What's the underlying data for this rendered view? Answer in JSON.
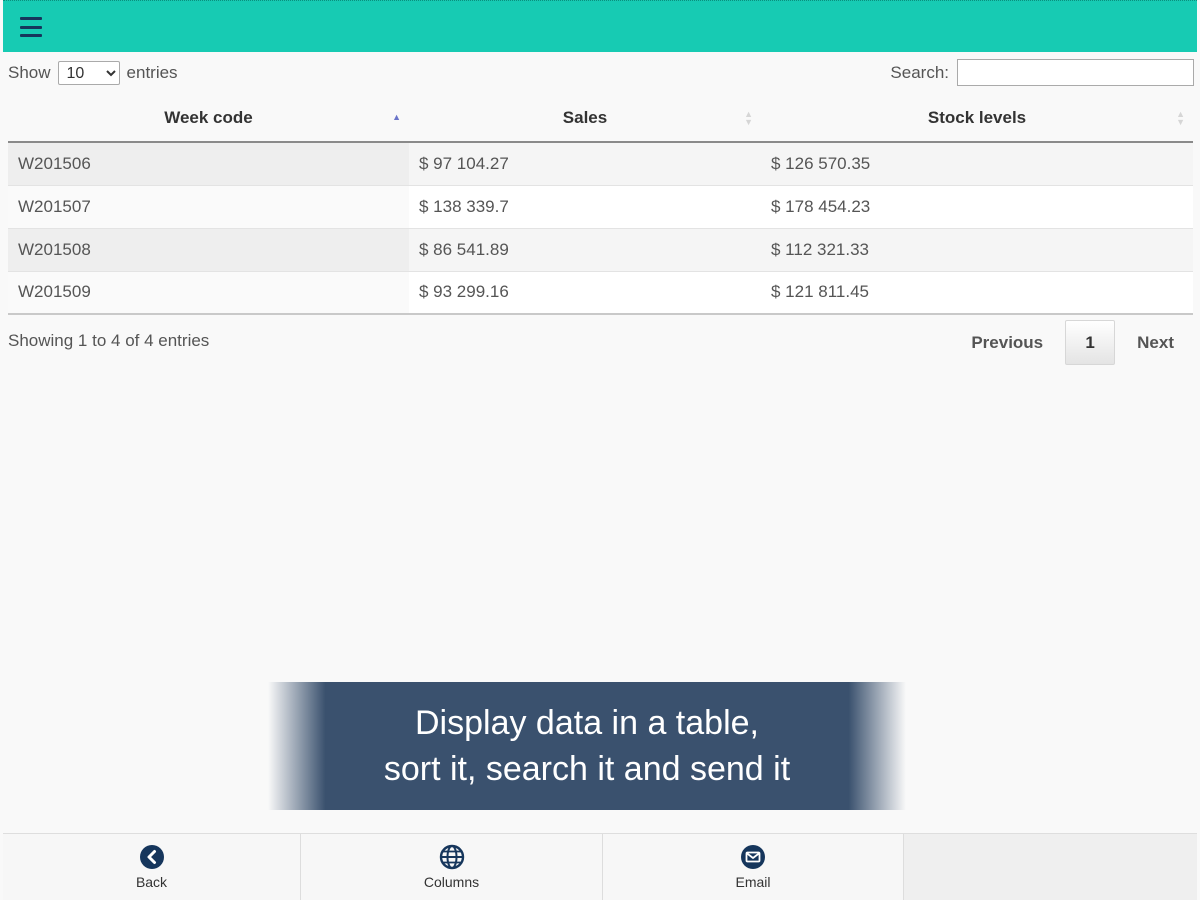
{
  "header": {
    "menu_icon": "hamburger-menu-icon"
  },
  "controls": {
    "show_label": "Show",
    "entries_label": "entries",
    "page_length": "10",
    "search_label": "Search:",
    "search_value": ""
  },
  "table": {
    "columns": [
      "Week code",
      "Sales",
      "Stock levels"
    ],
    "sorted_column": "Week code",
    "sort_direction": "ascending",
    "rows": [
      [
        "W201506",
        "$ 97 104.27",
        "$ 126 570.35"
      ],
      [
        "W201507",
        "$ 138 339.7",
        "$ 178 454.23"
      ],
      [
        "W201508",
        "$ 86 541.89",
        "$ 112 321.33"
      ],
      [
        "W201509",
        "$ 93 299.16",
        "$ 121 811.45"
      ]
    ]
  },
  "footer": {
    "info": "Showing 1 to 4 of 4 entries",
    "previous": "Previous",
    "current_page": "1",
    "next": "Next"
  },
  "overlay": {
    "line1": "Display data in a table,",
    "line2": "sort it, search it and send it"
  },
  "toolbar": {
    "back": {
      "label": "Back",
      "icon": "back-arrow-icon"
    },
    "columns": {
      "label": "Columns",
      "icon": "grid-globe-icon"
    },
    "email": {
      "label": "Email",
      "icon": "envelope-icon"
    }
  },
  "colors": {
    "topbar": "#17cbb3",
    "icon_navy": "#16365c",
    "overlay": "#3a516e",
    "sort_active": "#6a74c9"
  }
}
